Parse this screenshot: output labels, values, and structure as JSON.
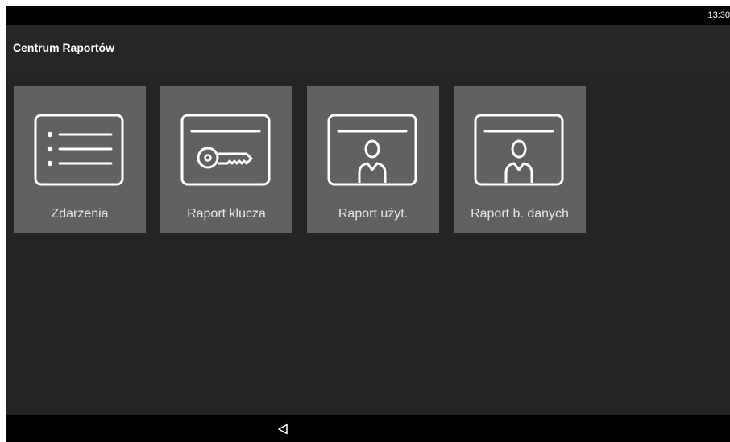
{
  "status_bar": {
    "time": "13:30"
  },
  "app_bar": {
    "title": "Centrum Raportów"
  },
  "tiles": [
    {
      "label": "Zdarzenia",
      "icon": "list-icon"
    },
    {
      "label": "Raport klucza",
      "icon": "key-card-icon"
    },
    {
      "label": "Raport użyt.",
      "icon": "user-card-icon"
    },
    {
      "label": "Raport b. danych",
      "icon": "user-card-icon"
    }
  ],
  "navigation": {
    "back_icon": "back-triangle-icon"
  },
  "colors": {
    "background": "#252525",
    "tile": "#616161",
    "bars": "#000000",
    "text": "#ffffff"
  }
}
